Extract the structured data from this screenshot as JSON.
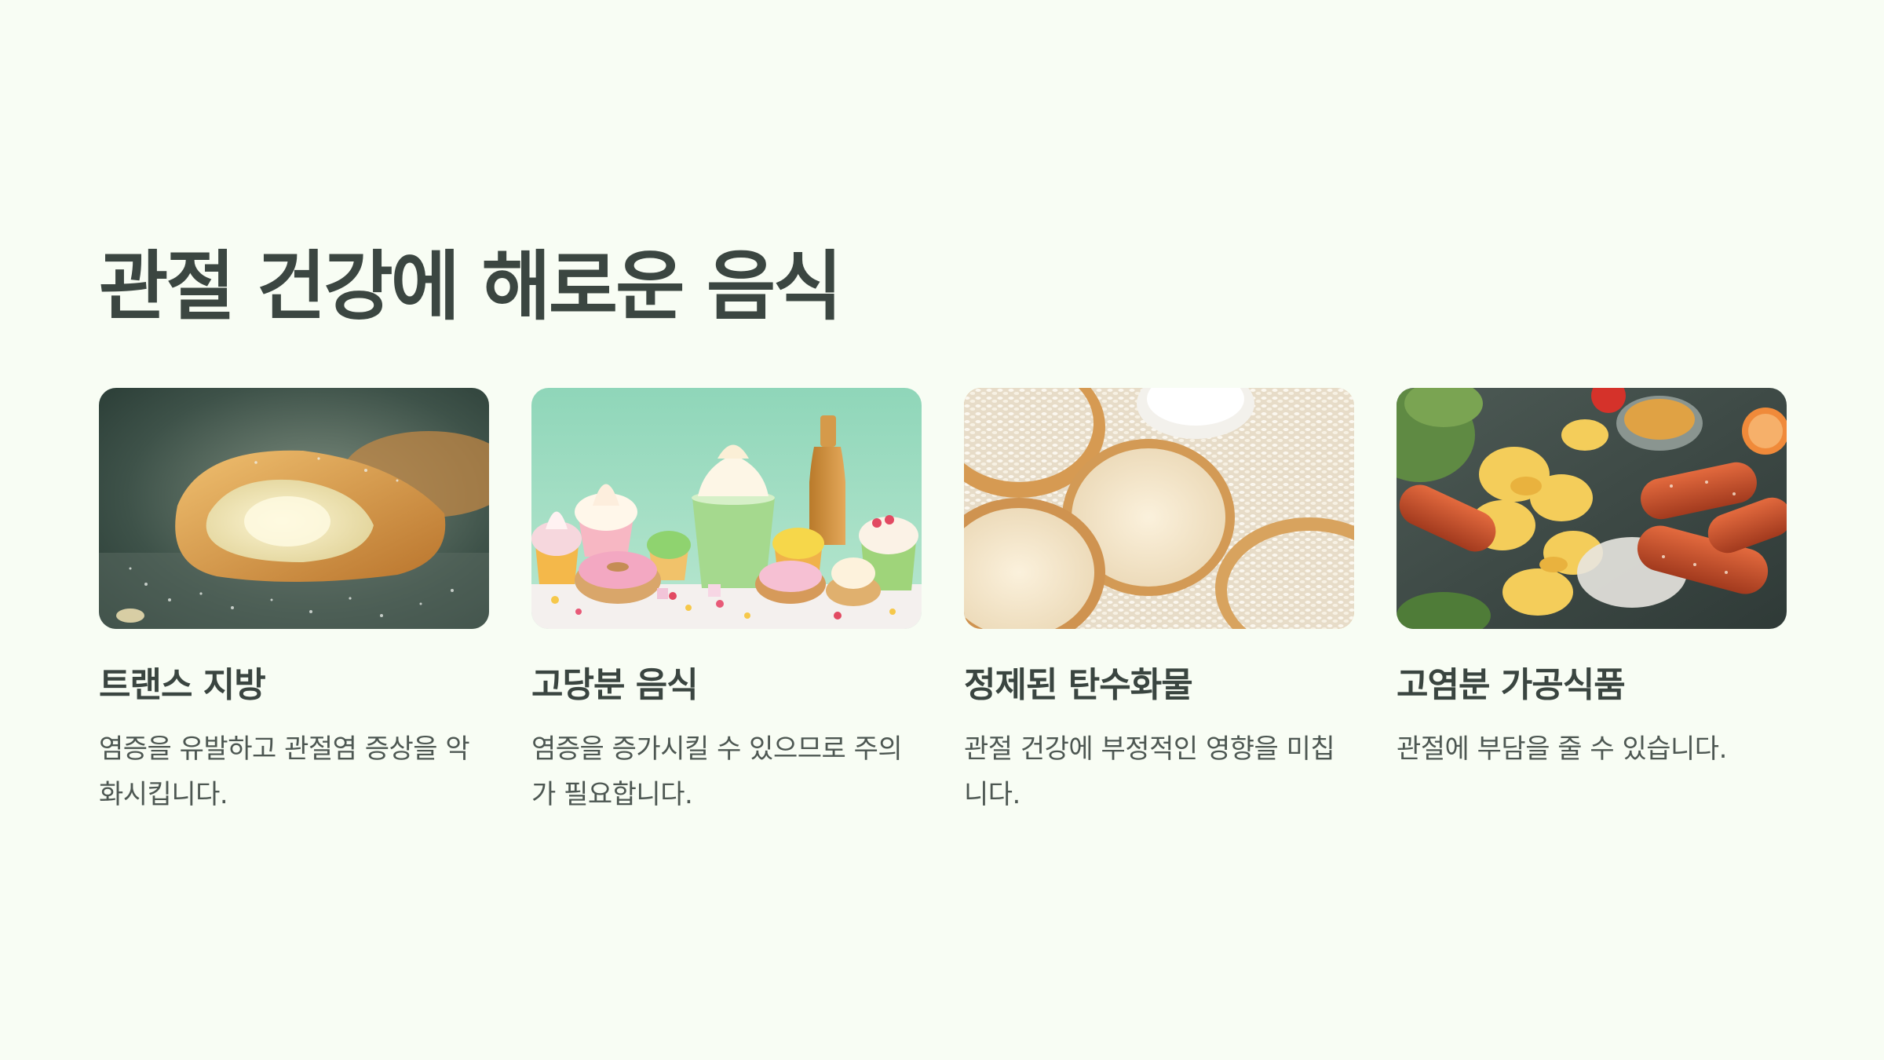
{
  "page": {
    "title": "관절 건강에 해로운 음식"
  },
  "cards": [
    {
      "title": "트랜스 지방",
      "description": "염증을 유발하고 관절염 증상을 악화시킵니다.",
      "image": "pastry-photo"
    },
    {
      "title": "고당분 음식",
      "description": "염증을 증가시킬 수 있으므로 주의가 필요합니다.",
      "image": "sweets-photo"
    },
    {
      "title": "정제된 탄수화물",
      "description": "관절 건강에 부정적인 영향을 미칩니다.",
      "image": "bread-rice-photo"
    },
    {
      "title": "고염분 가공식품",
      "description": "관절에 부담을 줄 수 있습니다.",
      "image": "sausage-chips-photo"
    }
  ],
  "colors": {
    "background": "#f8fdf4",
    "heading": "#3b4641",
    "body_text": "#4d5752"
  }
}
